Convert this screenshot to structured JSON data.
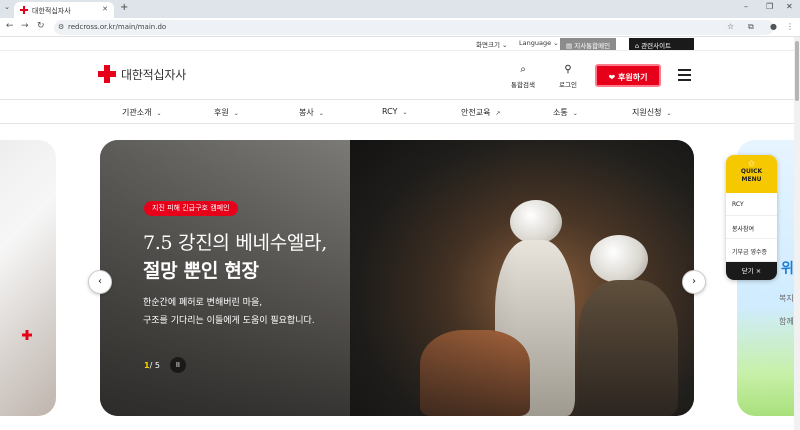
{
  "browser": {
    "tab_title": "대한적십자사",
    "url": "redcross.or.kr/main/main.do"
  },
  "utility": {
    "font_size": "화면크기",
    "language": "Language",
    "integrated_auth": "지사통합메인",
    "related_sites": "관련사이트"
  },
  "header": {
    "logo_text": "대한적십자사",
    "search_label": "통합검색",
    "login_label": "로그인",
    "donate_label": "후원하기"
  },
  "gnb": {
    "items": [
      {
        "label": "기관소개"
      },
      {
        "label": "후원"
      },
      {
        "label": "봉사"
      },
      {
        "label": "RCY"
      },
      {
        "label": "안전교육"
      },
      {
        "label": "소통"
      },
      {
        "label": "지원신청"
      }
    ]
  },
  "hero": {
    "badge": "지진 피해 긴급구호 캠페인",
    "title_line1": "7.5 강진의 베네수엘라,",
    "title_line2": "절망 뿐인 현장",
    "desc_line1": "한순간에 폐허로 변해버린 마을,",
    "desc_line2": "구조를 기다리는 이들에게 도움이 필요합니다.",
    "pager_current": "1",
    "pager_total": "/ 5",
    "pause": "II"
  },
  "quick_menu": {
    "title_line1": "QUICK",
    "title_line2": "MENU",
    "items": [
      {
        "label": "RCY"
      },
      {
        "label": "봉사참여"
      },
      {
        "label": "기부금 영수증"
      }
    ],
    "close_label": "닫기 ×"
  },
  "side_right": {
    "t1": "위",
    "t2": "복지",
    "t3": "함께"
  },
  "colors": {
    "brand_red": "#e6001a",
    "quick_yellow": "#f6c800"
  }
}
